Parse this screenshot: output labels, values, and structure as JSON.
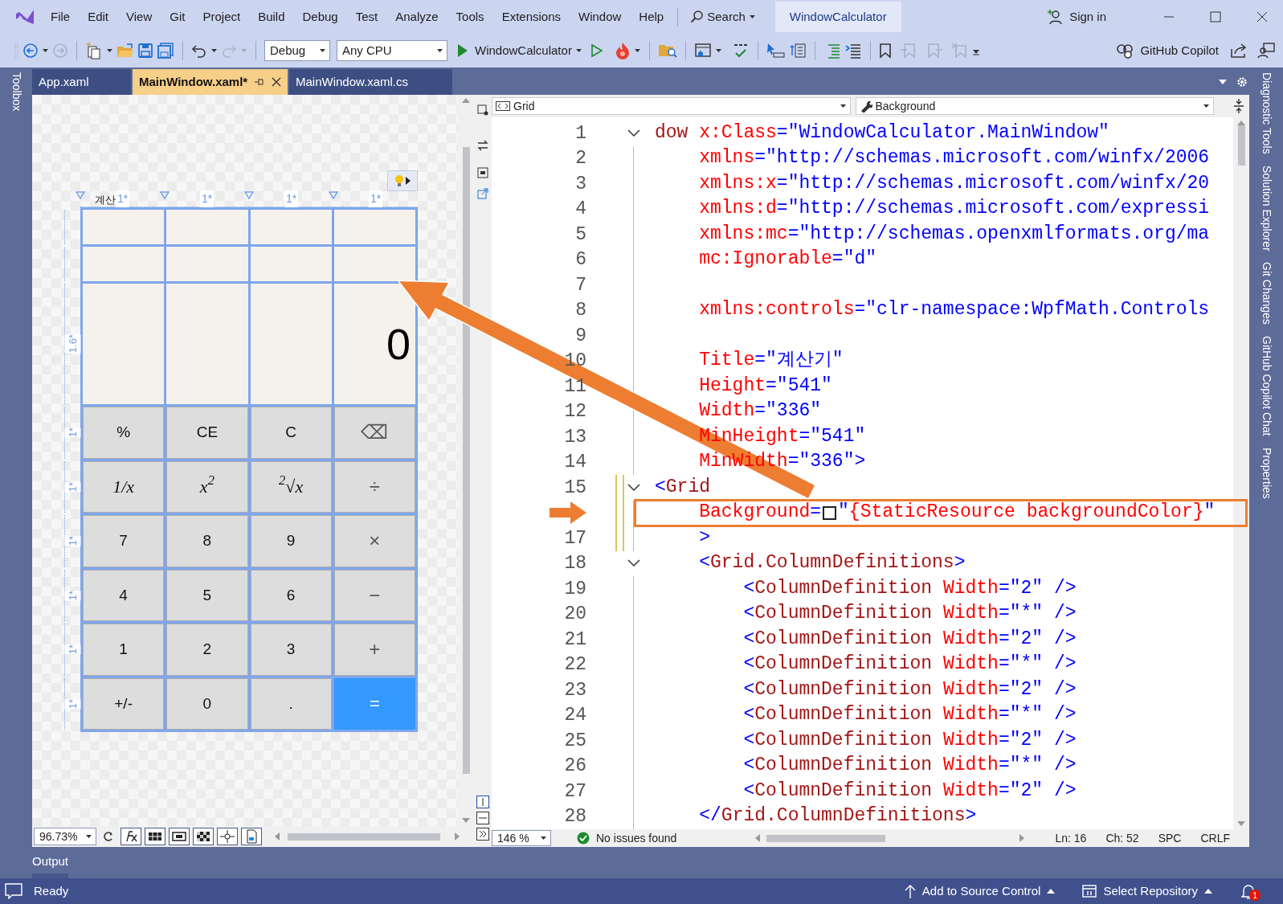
{
  "window": {
    "title": "WindowCalculator"
  },
  "menu": [
    "File",
    "Edit",
    "View",
    "Git",
    "Project",
    "Build",
    "Debug",
    "Test",
    "Analyze",
    "Tools",
    "Extensions",
    "Window",
    "Help"
  ],
  "search": {
    "label": "Search"
  },
  "account": {
    "label": "Sign in"
  },
  "toolbar": {
    "configuration": "Debug",
    "platform": "Any CPU",
    "start_target": "WindowCalculator",
    "copilot": "GitHub Copilot"
  },
  "side_panels": {
    "left": [
      "Toolbox"
    ],
    "right": [
      "Diagnostic Tools",
      "Solution Explorer",
      "Git Changes",
      "GitHub Copilot Chat",
      "Properties"
    ]
  },
  "tabs": [
    {
      "label": "App.xaml",
      "selected": false
    },
    {
      "label": "MainWindow.xaml*",
      "selected": true
    },
    {
      "label": "MainWindow.xaml.cs",
      "selected": false
    }
  ],
  "designer": {
    "window_title": "계산",
    "column_labels": [
      "1*",
      "1*",
      "1*",
      "1*"
    ],
    "row_labels": [
      "1.6*",
      "1*",
      "1*",
      "1*",
      "1*",
      "1*",
      "1*"
    ],
    "display": "0",
    "keys": [
      {
        "label": "%",
        "kind": "function"
      },
      {
        "label": "CE",
        "kind": "function"
      },
      {
        "label": "C",
        "kind": "function"
      },
      {
        "label": "⌫",
        "kind": "operator"
      },
      {
        "label": "1/*x*",
        "kind": "math"
      },
      {
        "label": "*x*$^{2}$",
        "kind": "math"
      },
      {
        "label": "$^{2}$√*x*",
        "kind": "math"
      },
      {
        "label": "÷",
        "kind": "operator"
      },
      {
        "label": "7",
        "kind": "digit"
      },
      {
        "label": "8",
        "kind": "digit"
      },
      {
        "label": "9",
        "kind": "digit"
      },
      {
        "label": "×",
        "kind": "operator"
      },
      {
        "label": "4",
        "kind": "digit"
      },
      {
        "label": "5",
        "kind": "digit"
      },
      {
        "label": "6",
        "kind": "digit"
      },
      {
        "label": "−",
        "kind": "operator"
      },
      {
        "label": "1",
        "kind": "digit"
      },
      {
        "label": "2",
        "kind": "digit"
      },
      {
        "label": "3",
        "kind": "digit"
      },
      {
        "label": "+",
        "kind": "operator"
      },
      {
        "label": "+/-",
        "kind": "function"
      },
      {
        "label": "0",
        "kind": "digit"
      },
      {
        "label": ".",
        "kind": "digit"
      },
      {
        "label": "=",
        "kind": "equals"
      }
    ],
    "zoom": "96.73%"
  },
  "editor": {
    "element": "Grid",
    "property": "Background",
    "lines": [
      {
        "number": "1",
        "fold": true,
        "tokens": [
          {
            "kind": "tag",
            "text": "dow "
          },
          {
            "kind": "attr",
            "text": "x:Class"
          },
          {
            "kind": "value",
            "text": "=\"WindowCalculator.MainWindow\""
          }
        ]
      },
      {
        "number": "2",
        "tokens": [
          {
            "kind": "attr",
            "text": "    xmlns"
          },
          {
            "kind": "value",
            "text": "=\"http://schemas.microsoft.com/winfx/2006"
          }
        ]
      },
      {
        "number": "3",
        "tokens": [
          {
            "kind": "attr",
            "text": "    xmlns:x"
          },
          {
            "kind": "value",
            "text": "=\"http://schemas.microsoft.com/winfx/20"
          }
        ]
      },
      {
        "number": "4",
        "tokens": [
          {
            "kind": "attr",
            "text": "    xmlns:d"
          },
          {
            "kind": "value",
            "text": "=\"http://schemas.microsoft.com/expressi"
          }
        ]
      },
      {
        "number": "5",
        "tokens": [
          {
            "kind": "attr",
            "text": "    xmlns:mc"
          },
          {
            "kind": "value",
            "text": "=\"http://schemas.openxmlformats.org/ma"
          }
        ]
      },
      {
        "number": "6",
        "tokens": [
          {
            "kind": "attr",
            "text": "    mc:Ignorable"
          },
          {
            "kind": "value",
            "text": "=\"d\""
          }
        ]
      },
      {
        "number": "7"
      },
      {
        "number": "8",
        "tokens": [
          {
            "kind": "attr",
            "text": "    xmlns:controls"
          },
          {
            "kind": "value",
            "text": "=\"clr-namespace:WpfMath.Controls"
          }
        ]
      },
      {
        "number": "9"
      },
      {
        "number": "10",
        "tokens": [
          {
            "kind": "attr",
            "text": "    Title"
          },
          {
            "kind": "value",
            "text": "=\"계산기\""
          }
        ]
      },
      {
        "number": "11",
        "tokens": [
          {
            "kind": "attr",
            "text": "    Height"
          },
          {
            "kind": "value",
            "text": "=\"541\""
          }
        ]
      },
      {
        "number": "12",
        "tokens": [
          {
            "kind": "attr",
            "text": "    Width"
          },
          {
            "kind": "value",
            "text": "=\"336\""
          }
        ]
      },
      {
        "number": "13",
        "tokens": [
          {
            "kind": "attr",
            "text": "    MinHeight"
          },
          {
            "kind": "value",
            "text": "=\"541\""
          }
        ]
      },
      {
        "number": "14",
        "tokens": [
          {
            "kind": "attr",
            "text": "    MinWidth"
          },
          {
            "kind": "value",
            "text": "=\"336\">"
          }
        ]
      },
      {
        "number": "15",
        "fold": true,
        "modified": true,
        "tokens": [
          {
            "kind": "punct",
            "text": "<"
          },
          {
            "kind": "tag",
            "text": "Grid"
          }
        ]
      },
      {
        "modified": true,
        "highlighted": true,
        "tokens": [
          {
            "kind": "attr",
            "text": "    Background"
          },
          {
            "kind": "punct",
            "text": "="
          },
          {
            "kind": "swatch"
          },
          {
            "kind": "punct",
            "text": "\""
          },
          {
            "kind": "attr",
            "text": "{StaticResource backgroundColor}"
          },
          {
            "kind": "punct",
            "text": "\""
          }
        ]
      },
      {
        "number": "17",
        "modified": true,
        "tokens": [
          {
            "kind": "punct",
            "text": "    >"
          }
        ]
      },
      {
        "number": "18",
        "fold": true,
        "tokens": [
          {
            "kind": "punct",
            "text": "    <"
          },
          {
            "kind": "tag",
            "text": "Grid.ColumnDefinitions"
          },
          {
            "kind": "punct",
            "text": ">"
          }
        ]
      },
      {
        "number": "19",
        "tokens": [
          {
            "kind": "punct",
            "text": "        <"
          },
          {
            "kind": "tag",
            "text": "ColumnDefinition "
          },
          {
            "kind": "attr",
            "text": "Width"
          },
          {
            "kind": "value",
            "text": "=\"2\" />"
          }
        ]
      },
      {
        "number": "20",
        "tokens": [
          {
            "kind": "punct",
            "text": "        <"
          },
          {
            "kind": "tag",
            "text": "ColumnDefinition "
          },
          {
            "kind": "attr",
            "text": "Width"
          },
          {
            "kind": "value",
            "text": "=\"*\" />"
          }
        ]
      },
      {
        "number": "21",
        "tokens": [
          {
            "kind": "punct",
            "text": "        <"
          },
          {
            "kind": "tag",
            "text": "ColumnDefinition "
          },
          {
            "kind": "attr",
            "text": "Width"
          },
          {
            "kind": "value",
            "text": "=\"2\" />"
          }
        ]
      },
      {
        "number": "22",
        "tokens": [
          {
            "kind": "punct",
            "text": "        <"
          },
          {
            "kind": "tag",
            "text": "ColumnDefinition "
          },
          {
            "kind": "attr",
            "text": "Width"
          },
          {
            "kind": "value",
            "text": "=\"*\" />"
          }
        ]
      },
      {
        "number": "23",
        "tokens": [
          {
            "kind": "punct",
            "text": "        <"
          },
          {
            "kind": "tag",
            "text": "ColumnDefinition "
          },
          {
            "kind": "attr",
            "text": "Width"
          },
          {
            "kind": "value",
            "text": "=\"2\" />"
          }
        ]
      },
      {
        "number": "24",
        "tokens": [
          {
            "kind": "punct",
            "text": "        <"
          },
          {
            "kind": "tag",
            "text": "ColumnDefinition "
          },
          {
            "kind": "attr",
            "text": "Width"
          },
          {
            "kind": "value",
            "text": "=\"*\" />"
          }
        ]
      },
      {
        "number": "25",
        "tokens": [
          {
            "kind": "punct",
            "text": "        <"
          },
          {
            "kind": "tag",
            "text": "ColumnDefinition "
          },
          {
            "kind": "attr",
            "text": "Width"
          },
          {
            "kind": "value",
            "text": "=\"2\" />"
          }
        ]
      },
      {
        "number": "26",
        "tokens": [
          {
            "kind": "punct",
            "text": "        <"
          },
          {
            "kind": "tag",
            "text": "ColumnDefinition "
          },
          {
            "kind": "attr",
            "text": "Width"
          },
          {
            "kind": "value",
            "text": "=\"*\" />"
          }
        ]
      },
      {
        "number": "27",
        "tokens": [
          {
            "kind": "punct",
            "text": "        <"
          },
          {
            "kind": "tag",
            "text": "ColumnDefinition "
          },
          {
            "kind": "attr",
            "text": "Width"
          },
          {
            "kind": "value",
            "text": "=\"2\" />"
          }
        ]
      },
      {
        "number": "28",
        "tokens": [
          {
            "kind": "punct",
            "text": "    </"
          },
          {
            "kind": "tag",
            "text": "Grid.ColumnDefinitions"
          },
          {
            "kind": "punct",
            "text": ">"
          }
        ]
      }
    ],
    "zoom": "146 %",
    "issues": "No issues found",
    "line": "Ln: 16",
    "column": "Ch: 52",
    "indentation": "SPC",
    "line_ending": "CRLF"
  },
  "output_tab": "Output",
  "status_bar": {
    "message": "Ready",
    "source_control": "Add to Source Control",
    "repository": "Select Repository",
    "notifications": "1"
  }
}
